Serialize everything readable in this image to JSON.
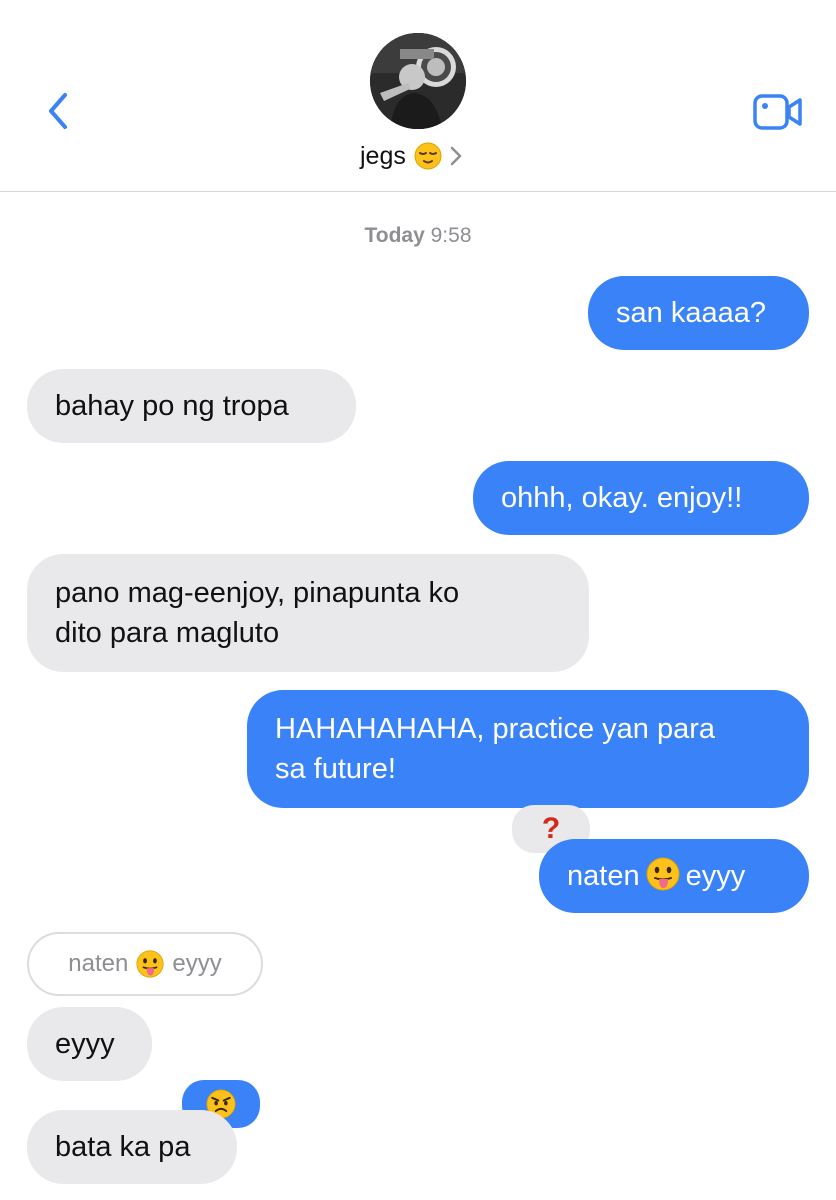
{
  "header": {
    "back_icon": "chevron-left-icon",
    "contact_name": "jegs",
    "contact_emoji": "relieved-face-emoji",
    "chevron_icon": "chevron-right-icon",
    "video_icon": "video-camera-icon",
    "accent_color": "#3a82f7"
  },
  "timestamp": {
    "day": "Today",
    "time": "9:58"
  },
  "messages": [
    {
      "direction": "outgoing",
      "text": "san kaaaa?"
    },
    {
      "direction": "incoming",
      "text": "bahay po ng tropa"
    },
    {
      "direction": "outgoing",
      "text": "ohhh, okay. enjoy!!"
    },
    {
      "direction": "incoming",
      "line1": "pano mag-eenjoy, pinapunta ko",
      "line2": "dito para magluto"
    },
    {
      "direction": "outgoing",
      "line1": "HAHAHAHAHA, practice yan para",
      "line2": "sa future!",
      "tapback": "?"
    },
    {
      "direction": "outgoing",
      "before": "naten",
      "after": "eyyy",
      "emoji": "tongue-out-face-emoji"
    },
    {
      "direction": "incoming",
      "reply_to_before": "naten",
      "reply_to_after": "eyyy",
      "text": "eyyy"
    },
    {
      "direction": "incoming",
      "text": "bata ka pa",
      "tapback": "angry-face-emoji"
    }
  ]
}
